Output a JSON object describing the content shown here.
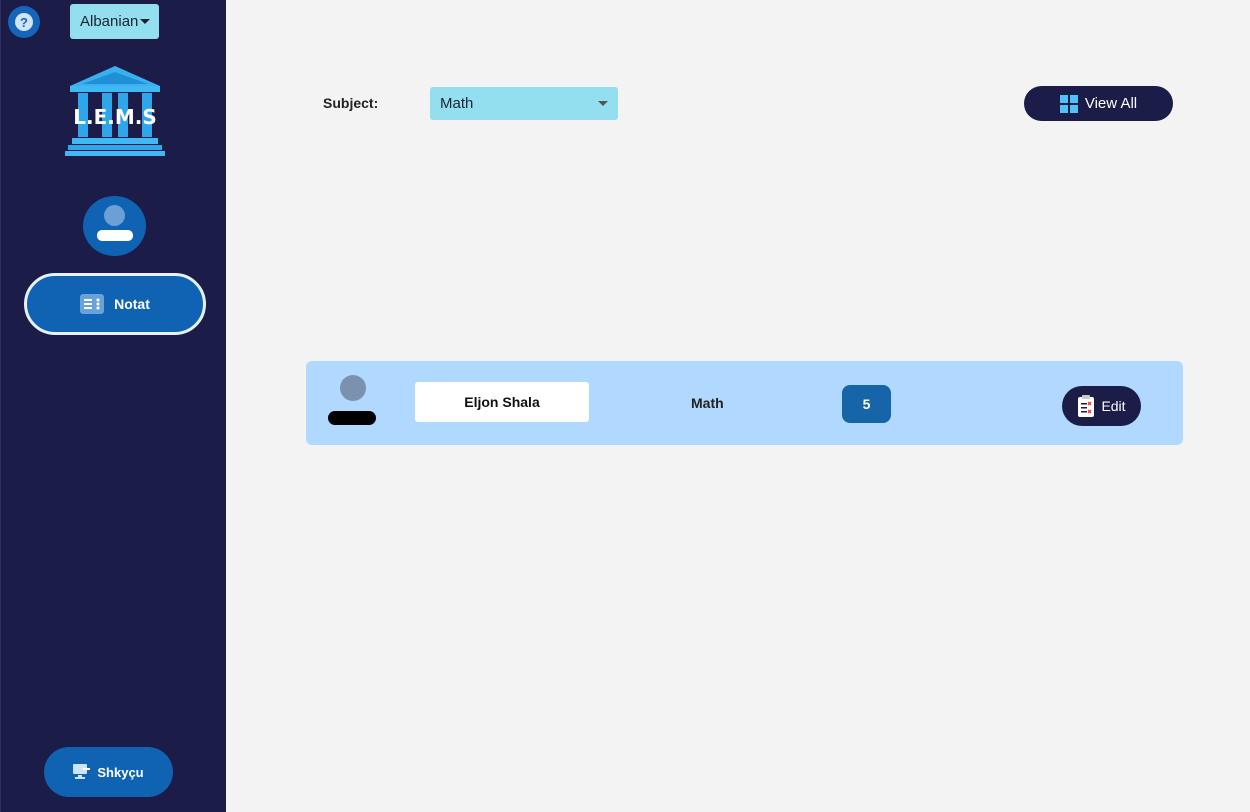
{
  "sidebar": {
    "help_icon_glyph": "?",
    "language": {
      "selected": "Albanian"
    },
    "logo_text": "L.E.M.S",
    "nav_notat_label": "Notat",
    "logout_label": "Shkyçu"
  },
  "filter": {
    "subject_label": "Subject:",
    "subject_selected": "Math",
    "view_all_label": "View All"
  },
  "rows": [
    {
      "name": "Eljon Shala",
      "subject": "Math",
      "grade": "5",
      "edit_label": "Edit"
    }
  ],
  "colors": {
    "sidebar_bg": "#1b1c48",
    "accent_blue": "#0f63b2",
    "select_bg": "#93dff0",
    "row_bg": "#b1d9ff",
    "content_bg": "#f3f3f3"
  },
  "icons": {
    "help": "question-mark-icon",
    "logo": "institution-building-icon",
    "avatar": "user-avatar-icon",
    "notat": "list-icon",
    "logout": "logout-monitor-icon",
    "view_all": "grid-icon",
    "edit": "clipboard-edit-icon"
  }
}
